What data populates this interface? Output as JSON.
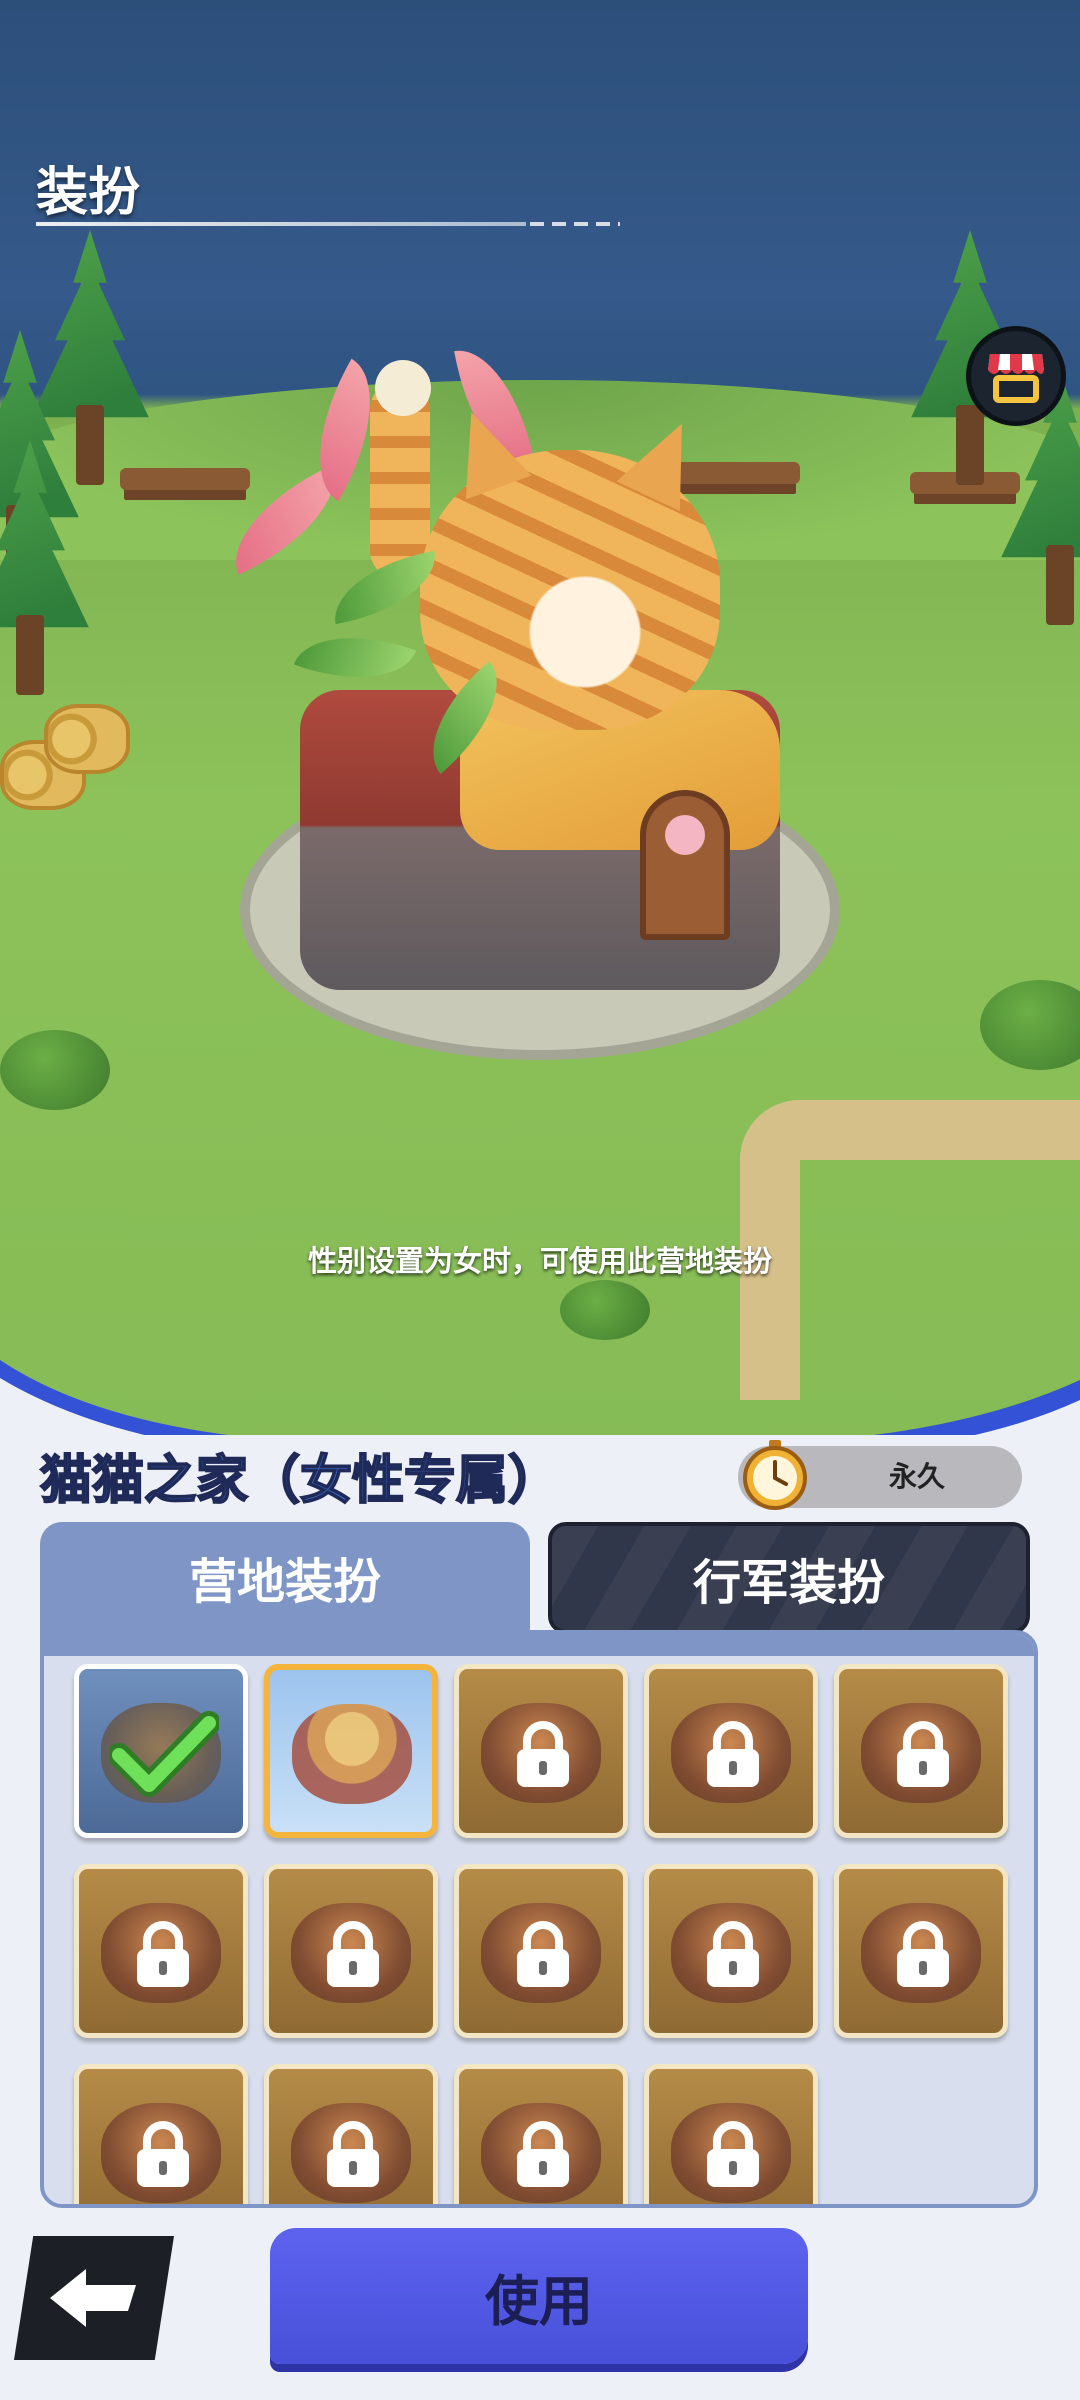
{
  "header": {
    "title": "装扮"
  },
  "scene": {
    "hint": "性别设置为女时，可使用此营地装扮"
  },
  "skin": {
    "name": "猫猫之家（女性专属）",
    "duration": "永久"
  },
  "tabs": [
    {
      "label": "营地装扮",
      "active": true
    },
    {
      "label": "行军装扮",
      "active": false
    }
  ],
  "grid": {
    "items": [
      {
        "state": "equipped"
      },
      {
        "state": "selected"
      },
      {
        "state": "locked"
      },
      {
        "state": "locked"
      },
      {
        "state": "locked"
      },
      {
        "state": "locked"
      },
      {
        "state": "locked"
      },
      {
        "state": "locked"
      },
      {
        "state": "locked"
      },
      {
        "state": "locked"
      },
      {
        "state": "locked"
      },
      {
        "state": "locked"
      },
      {
        "state": "locked"
      },
      {
        "state": "locked"
      }
    ]
  },
  "actions": {
    "use_label": "使用"
  },
  "icons": {
    "shop": "shop-stall-icon",
    "clock": "stopwatch-icon",
    "lock": "padlock-icon",
    "check": "checkmark-icon",
    "back": "back-arrow-icon"
  },
  "colors": {
    "accent_blue": "#4f56e0",
    "tab_active": "#7e95c6",
    "tab_inactive": "#363c4e",
    "selected_border": "#f5b43b",
    "equipped_check": "#5bd14a",
    "skin_name": "#3a6fd0"
  }
}
